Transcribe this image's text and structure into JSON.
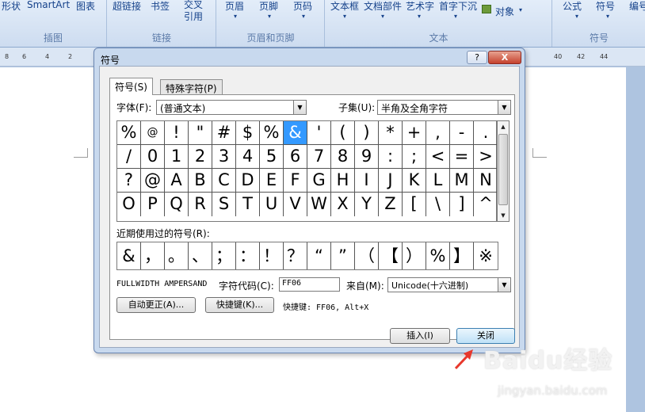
{
  "ribbon": {
    "groups": [
      {
        "label": "插图",
        "buttons": [
          "形状",
          "SmartArt",
          "图表"
        ]
      },
      {
        "label": "链接",
        "buttons": [
          "超链接",
          "书签",
          "交叉引用"
        ]
      },
      {
        "label": "页眉和页脚",
        "buttons": [
          "页眉",
          "页脚",
          "页码"
        ]
      },
      {
        "label": "文本",
        "buttons": [
          "文本框",
          "文档部件",
          "艺术字",
          "首字下沉",
          "对象"
        ]
      },
      {
        "label": "符号",
        "buttons": [
          "公式",
          "符号",
          "编号"
        ]
      }
    ]
  },
  "ruler": {
    "left_ticks": [
      "8",
      "6",
      "4",
      "2"
    ],
    "right_ticks": [
      "40",
      "42",
      "44"
    ]
  },
  "dialog": {
    "title": "符号",
    "help_label": "?",
    "close_glyph": "X",
    "tabs": [
      "符号(S)",
      "特殊字符(P)"
    ],
    "font_label": "字体(F):",
    "font_value": "(普通文本)",
    "subset_label": "子集(U):",
    "subset_value": "半角及全角字符",
    "symbols": [
      [
        "%",
        "@",
        "!",
        "\"",
        "#",
        "$",
        "%",
        "&",
        "'",
        "(",
        ")",
        "*",
        "+",
        ",",
        "-",
        "."
      ],
      [
        "/",
        "0",
        "1",
        "2",
        "3",
        "4",
        "5",
        "6",
        "7",
        "8",
        "9",
        ":",
        ";",
        "<",
        "=",
        ">"
      ],
      [
        "?",
        "@",
        "A",
        "B",
        "C",
        "D",
        "E",
        "F",
        "G",
        "H",
        "I",
        "J",
        "K",
        "L",
        "M",
        "N"
      ],
      [
        "O",
        "P",
        "Q",
        "R",
        "S",
        "T",
        "U",
        "V",
        "W",
        "X",
        "Y",
        "Z",
        "[",
        "\\",
        "]",
        "^"
      ]
    ],
    "selected_symbol": "&",
    "recent_label": "近期使用过的符号(R):",
    "recent_symbols": [
      "&",
      "，",
      "。",
      "、",
      "；",
      "：",
      "！",
      "？",
      "“",
      "”",
      "（",
      "【",
      "）",
      "%",
      "】",
      "※"
    ],
    "char_name": "FULLWIDTH AMPERSAND",
    "char_code_label": "字符代码(C):",
    "char_code_value": "FF06",
    "from_label": "来自(M):",
    "from_value": "Unicode(十六进制)",
    "autocorrect_label": "自动更正(A)...",
    "shortcut_key_label": "快捷键(K)...",
    "shortcut_info": "快捷键: FF06, Alt+X",
    "insert_label": "插入(I)",
    "close_label": "关闭"
  },
  "watermark": {
    "brand": "Baidu经验",
    "url": "jingyan.baidu.com"
  },
  "colors": {
    "selected": "#3399ff",
    "arrow": "#e8382c"
  }
}
